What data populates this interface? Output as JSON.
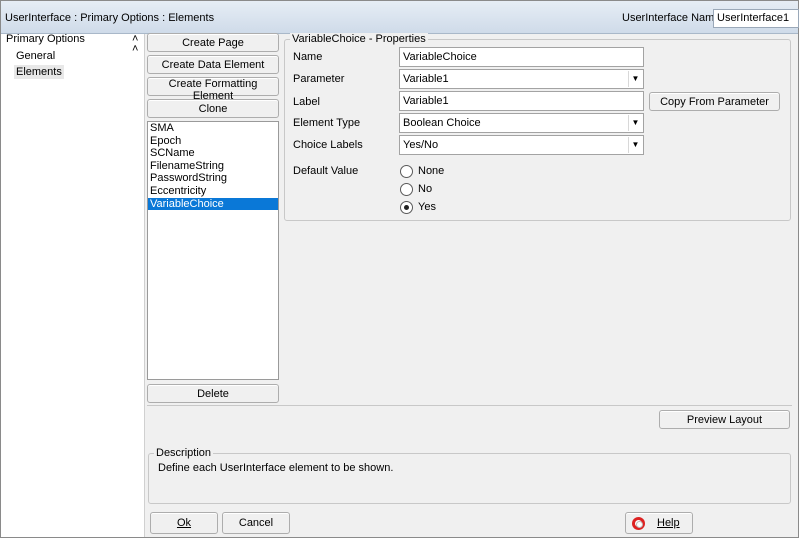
{
  "header": {
    "breadcrumb": "UserInterface : Primary Options : Elements",
    "name_label": "UserInterface Name",
    "name_value": "UserInterface1"
  },
  "sidebar": {
    "items": [
      {
        "label": "Primary Options"
      },
      {
        "label": "General"
      },
      {
        "label": "Elements"
      }
    ]
  },
  "element_buttons": {
    "create_page": "Create Page",
    "create_data_element": "Create Data Element",
    "create_formatting_element": "Create Formatting Element",
    "clone": "Clone",
    "delete": "Delete"
  },
  "elements_list": [
    "SMA",
    "Epoch",
    "SCName",
    "FilenameString",
    "PasswordString",
    "Eccentricity",
    "VariableChoice"
  ],
  "selected_element": "VariableChoice",
  "properties": {
    "legend": "VariableChoice - Properties",
    "name_label": "Name",
    "name_value": "VariableChoice",
    "parameter_label": "Parameter",
    "parameter_value": "Variable1",
    "label_label": "Label",
    "label_value": "Variable1",
    "copy_from_parameter": "Copy From Parameter",
    "element_type_label": "Element Type",
    "element_type_value": "Boolean Choice",
    "choice_labels_label": "Choice Labels",
    "choice_labels_value": "Yes/No",
    "default_value_label": "Default Value",
    "default_options": [
      "None",
      "No",
      "Yes"
    ],
    "default_selected": "Yes"
  },
  "preview_layout": "Preview Layout",
  "description": {
    "legend": "Description",
    "text": "Define each UserInterface element to be shown."
  },
  "footer": {
    "ok": "Ok",
    "cancel": "Cancel",
    "help": "Help"
  },
  "colors": {
    "selection": "#0a78d7",
    "header_top": "#e6edf5",
    "header_bottom": "#cfdbe9"
  }
}
